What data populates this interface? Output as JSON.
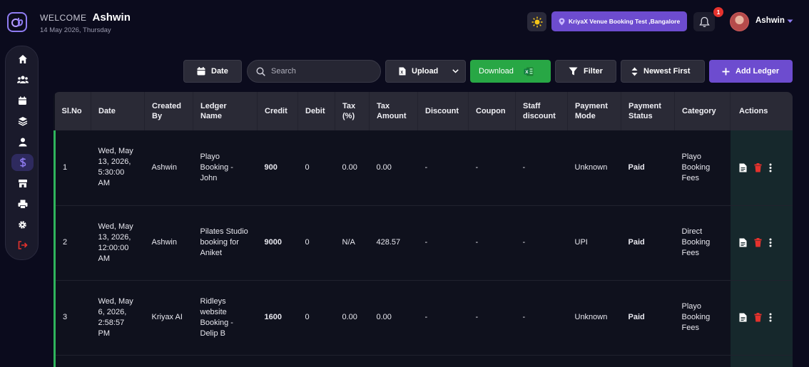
{
  "header": {
    "welcome_label": "WELCOME",
    "user_name": "Ashwin",
    "date": "14 May 2026, Thursday",
    "venue": "KriyaX Venue Booking Test ,Bangalore",
    "notification_count": "1",
    "profile_name": "Ashwin"
  },
  "sidebar": {
    "items": [
      {
        "icon": "home-icon"
      },
      {
        "icon": "users-icon"
      },
      {
        "icon": "calendar-icon"
      },
      {
        "icon": "layers-icon"
      },
      {
        "icon": "user-icon"
      },
      {
        "icon": "dollar-icon",
        "active": true
      },
      {
        "icon": "store-icon"
      },
      {
        "icon": "printer-icon"
      },
      {
        "icon": "gear-icon"
      },
      {
        "icon": "logout-icon"
      }
    ]
  },
  "toolbar": {
    "date_label": "Date",
    "search_placeholder": "Search",
    "upload_label": "Upload",
    "download_label": "Download",
    "filter_label": "Filter",
    "sort_label": "Newest First",
    "add_label": "Add Ledger"
  },
  "colors": {
    "accent": "#6d4ccf",
    "download": "#28a745",
    "row_marker": "#2fb45c",
    "delete": "#e5322d"
  },
  "table": {
    "headers": [
      "Sl.No",
      "Date",
      "Created By",
      "Ledger Name",
      "Credit",
      "Debit",
      "Tax (%)",
      "Tax Amount",
      "Discount",
      "Coupon",
      "Staff discount",
      "Payment Mode",
      "Payment Status",
      "Category",
      "Actions"
    ],
    "rows": [
      {
        "sl": "1",
        "date": "Wed, May 13, 2026, 5:30:00 AM",
        "created_by": "Ashwin",
        "ledger_name": "Playo Booking - John",
        "credit": "900",
        "debit": "0",
        "tax_pct": "0.00",
        "tax_amount": "0.00",
        "discount": "-",
        "coupon": "-",
        "staff_discount": "-",
        "payment_mode": "Unknown",
        "payment_status": "Paid",
        "category": "Playo Booking Fees"
      },
      {
        "sl": "2",
        "date": "Wed, May 13, 2026, 12:00:00 AM",
        "created_by": "Ashwin",
        "ledger_name": "Pilates Studio booking for Aniket",
        "credit": "9000",
        "debit": "0",
        "tax_pct": "N/A",
        "tax_amount": "428.57",
        "discount": "-",
        "coupon": "-",
        "staff_discount": "-",
        "payment_mode": "UPI",
        "payment_status": "Paid",
        "category": "Direct Booking Fees"
      },
      {
        "sl": "3",
        "date": "Wed, May 6, 2026, 2:58:57 PM",
        "created_by": "Kriyax AI",
        "ledger_name": "Ridleys website Booking - Delip B",
        "credit": "1600",
        "debit": "0",
        "tax_pct": "0.00",
        "tax_amount": "0.00",
        "discount": "-",
        "coupon": "-",
        "staff_discount": "-",
        "payment_mode": "Unknown",
        "payment_status": "Paid",
        "category": "Playo Booking Fees"
      }
    ]
  }
}
